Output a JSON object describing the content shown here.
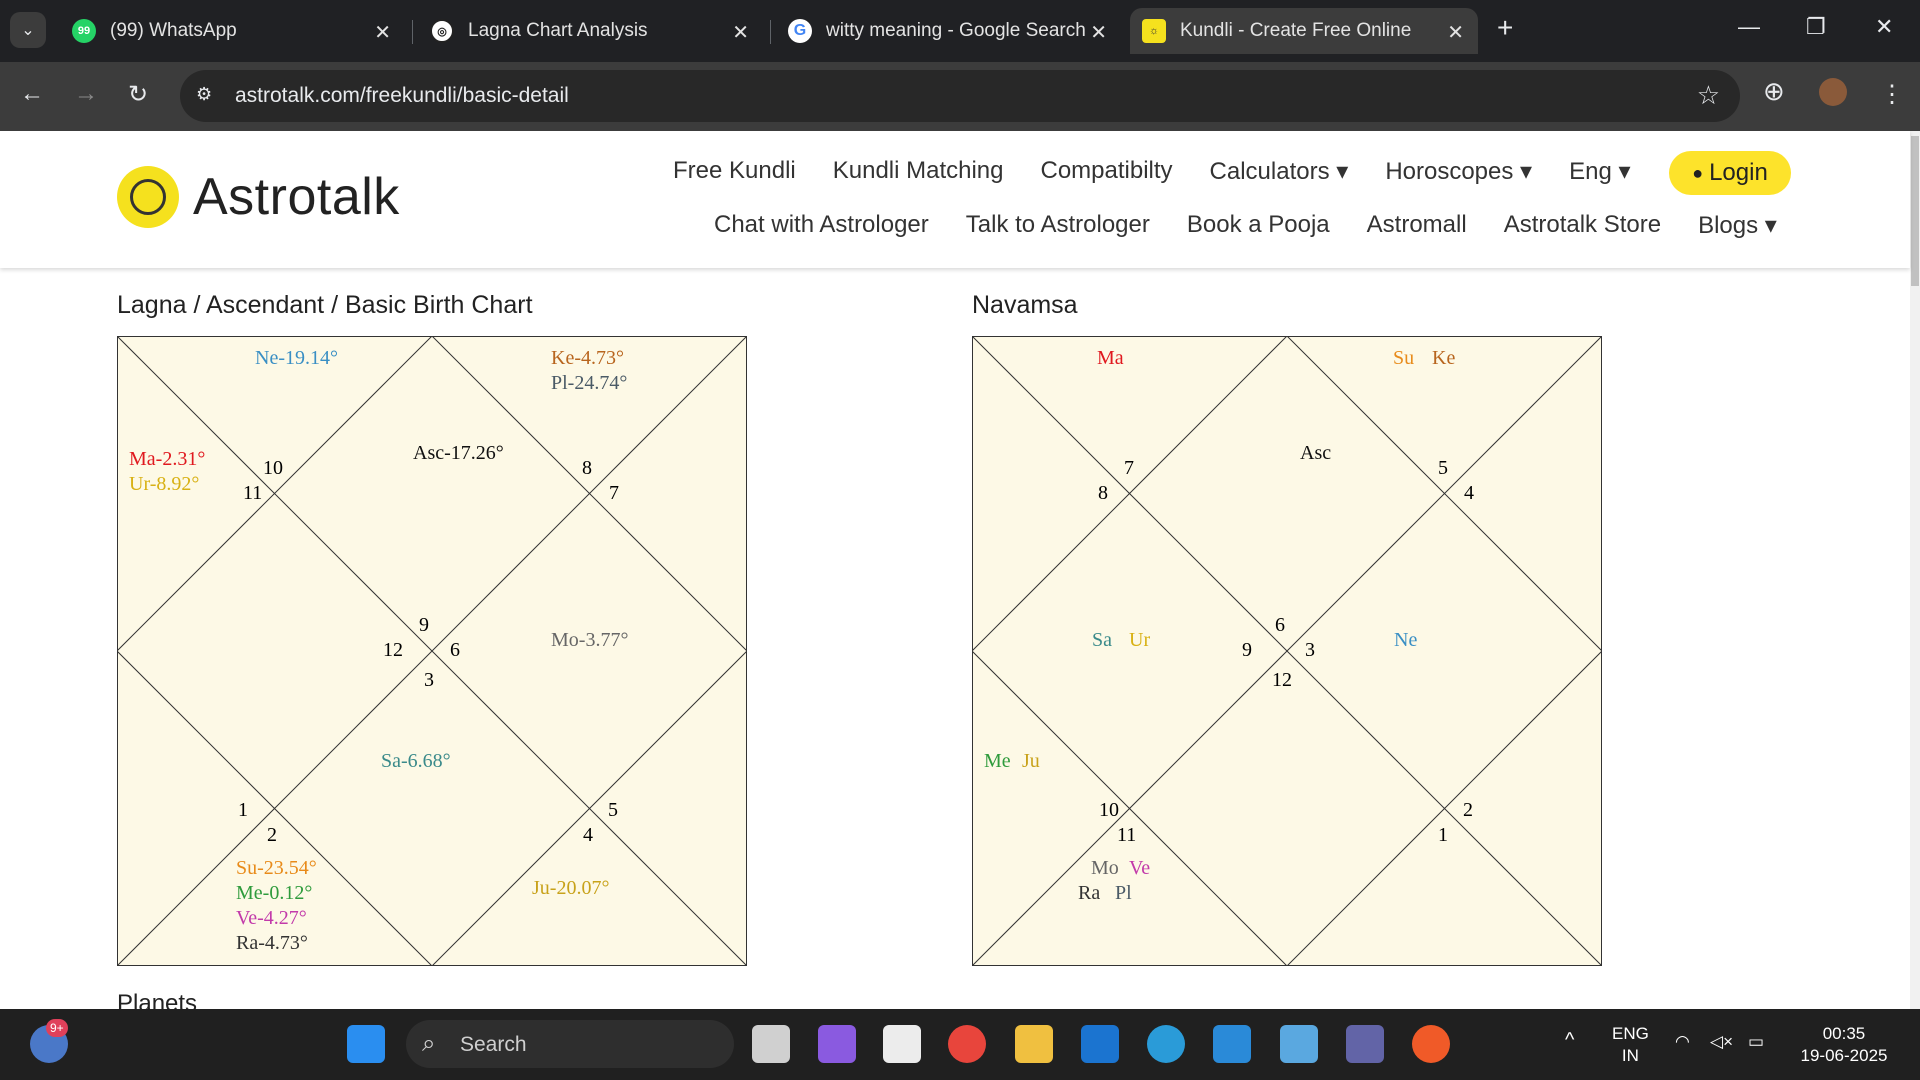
{
  "browser": {
    "tabs": [
      {
        "title": "(99) WhatsApp",
        "badge": "99"
      },
      {
        "title": "Lagna Chart Analysis"
      },
      {
        "title": "witty meaning - Google Search"
      },
      {
        "title": "Kundli - Create Free Online"
      }
    ],
    "new_tab": "+",
    "url": "astrotalk.com/freekundli/basic-detail"
  },
  "site": {
    "brand": "Astrotalk",
    "nav_row1": [
      "Free Kundli",
      "Kundli Matching",
      "Compatibilty",
      "Calculators ▾",
      "Horoscopes ▾",
      "Eng ▾"
    ],
    "nav_row2": [
      "Chat with Astrologer",
      "Talk to Astrologer",
      "Book a Pooja",
      "Astromall",
      "Astrotalk Store",
      "Blogs ▾"
    ],
    "login": "Login"
  },
  "charts": {
    "lagna": {
      "title": "Lagna / Ascendant / Basic Birth Chart",
      "labels": {
        "ne": "Ne-19.14°",
        "ke": "Ke-4.73°",
        "pl": "Pl-24.74°",
        "ma": "Ma-2.31°",
        "ur": "Ur-8.92°",
        "asc": "Asc-17.26°",
        "mo": "Mo-3.77°",
        "sa": "Sa-6.68°",
        "su": "Su-23.54°",
        "me": "Me-0.12°",
        "ve": "Ve-4.27°",
        "ra": "Ra-4.73°",
        "ju": "Ju-20.07°"
      },
      "houses": [
        "10",
        "11",
        "8",
        "7",
        "9",
        "12",
        "6",
        "3",
        "1",
        "2",
        "5",
        "4"
      ]
    },
    "navamsa": {
      "title": "Navamsa",
      "labels": {
        "ma": "Ma",
        "su": "Su",
        "ke": "Ke",
        "asc": "Asc",
        "sa": "Sa",
        "ur": "Ur",
        "ne": "Ne",
        "me": "Me",
        "ju": "Ju",
        "mo": "Mo",
        "ve": "Ve",
        "ra": "Ra",
        "pl": "Pl"
      },
      "houses": [
        "7",
        "8",
        "5",
        "4",
        "6",
        "9",
        "3",
        "12",
        "10",
        "11",
        "2",
        "1"
      ]
    },
    "colors": {
      "ne": "#3a8fc4",
      "ke": "#b8651e",
      "pl": "#4a5a66",
      "ma": "#e0191f",
      "ur": "#d8b114",
      "asc": "#111111",
      "mo": "#666666",
      "sa": "#3a8a8a",
      "su": "#e88b1a",
      "me": "#2f9b3c",
      "ve": "#c23aaa",
      "ra": "#333333",
      "ju": "#c8a21a"
    }
  },
  "next_section": "Planets",
  "taskbar": {
    "search": "Search",
    "notification_badge": "9+",
    "lang": "ENG",
    "region": "IN",
    "time": "00:35",
    "date": "19-06-2025"
  }
}
